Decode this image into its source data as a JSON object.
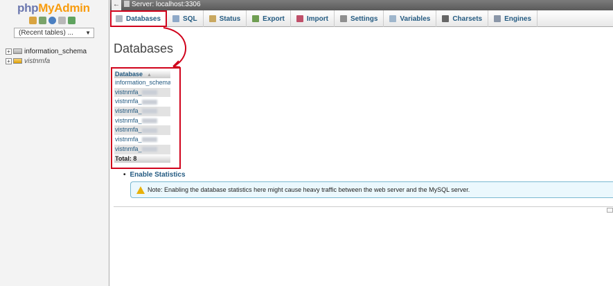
{
  "logo": {
    "php": "php",
    "myadmin": "MyAdmin"
  },
  "left": {
    "recent_tables": "(Recent tables) ...",
    "tree": [
      {
        "expander": "+",
        "label": "information_schema"
      },
      {
        "expander": "+",
        "label": "vistnmfa"
      }
    ]
  },
  "serverbar": {
    "back": "←",
    "server": "Server: localhost:3306"
  },
  "tabs": [
    {
      "label": "Databases",
      "icon": "database-icon",
      "color": "#b0b7c2"
    },
    {
      "label": "SQL",
      "icon": "sql-icon",
      "color": "#8ea9c8"
    },
    {
      "label": "Status",
      "icon": "status-icon",
      "color": "#c9a860"
    },
    {
      "label": "Export",
      "icon": "export-icon",
      "color": "#6f9e52"
    },
    {
      "label": "Import",
      "icon": "import-icon",
      "color": "#c0506a"
    },
    {
      "label": "Settings",
      "icon": "wrench-icon",
      "color": "#8f8f8f"
    },
    {
      "label": "Variables",
      "icon": "variables-icon",
      "color": "#9fb6cc"
    },
    {
      "label": "Charsets",
      "icon": "charsets-icon",
      "color": "#666666"
    },
    {
      "label": "Engines",
      "icon": "engines-icon",
      "color": "#8a96a8"
    }
  ],
  "main": {
    "title": "Databases",
    "table": {
      "header": "Database",
      "rows": [
        "information_schema",
        "vistnmfa_",
        "vistnmfa_",
        "vistnmfa_",
        "vistnmfa_",
        "vistnmfa_",
        "vistnmfa_",
        "vistnmfa_"
      ],
      "total": "Total: 8"
    },
    "enable_statistics": "Enable Statistics",
    "notice": "Note: Enabling the database statistics here might cause heavy traffic between the web server and the MySQL server."
  },
  "colors": {
    "highlight": "#d0021b",
    "link": "#235a81"
  }
}
